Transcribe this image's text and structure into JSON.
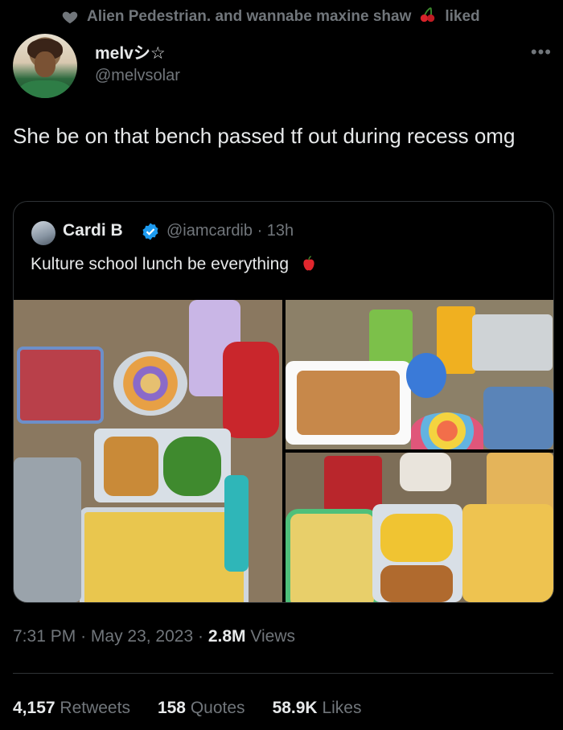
{
  "liked_by": "Alien Pedestrian. and wannabe maxine shaw",
  "liked_suffix": "liked",
  "author": {
    "name": "melvシ☆",
    "handle": "@melvsolar"
  },
  "tweet_text": "She be on that bench passed tf out during recess omg",
  "quote": {
    "name": "Cardi B",
    "handle": "@iamcardib",
    "time": "13h",
    "text": "Kulture school lunch be everything"
  },
  "timestamp": {
    "time": "7:31 PM",
    "date": "May 23, 2023",
    "views_count": "2.8M",
    "views_label": "Views"
  },
  "stats": {
    "retweets_count": "4,157",
    "retweets_label": "Retweets",
    "quotes_count": "158",
    "quotes_label": "Quotes",
    "likes_count": "58.9K",
    "likes_label": "Likes"
  },
  "colors": {
    "background": "#000000",
    "primary_text": "#e7e9ea",
    "secondary_text": "#71767b",
    "border": "#2f3336",
    "verified": "#1d9bf0"
  }
}
